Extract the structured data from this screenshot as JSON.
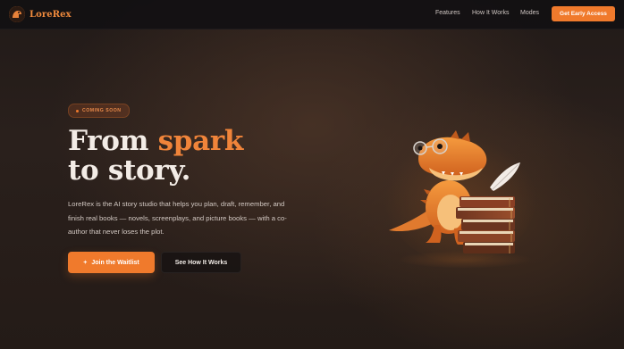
{
  "nav": {
    "brand": "LoreRex",
    "links": [
      "Features",
      "How It Works",
      "Modes"
    ],
    "cta": "Get Early Access"
  },
  "hero": {
    "badge": "COMING SOON",
    "headline_line1_plain": "From ",
    "headline_line1_accent": "spark",
    "headline_line2": "to story.",
    "description": "LoreRex is the AI story studio that helps you plan, draft, remember, and finish real books — novels, screenplays, and picture books — with a co-author that never loses the plot.",
    "primary_button": "Join the Waitlist",
    "primary_button_icon": "+",
    "secondary_button": "See How It Works"
  },
  "colors": {
    "accent": "#f07a2c",
    "background": "#231b18",
    "text": "#f3ece6"
  },
  "icons": {
    "brand_logo": "dinosaur-logo-icon",
    "mascot": "dinosaur-with-books-illustration"
  }
}
